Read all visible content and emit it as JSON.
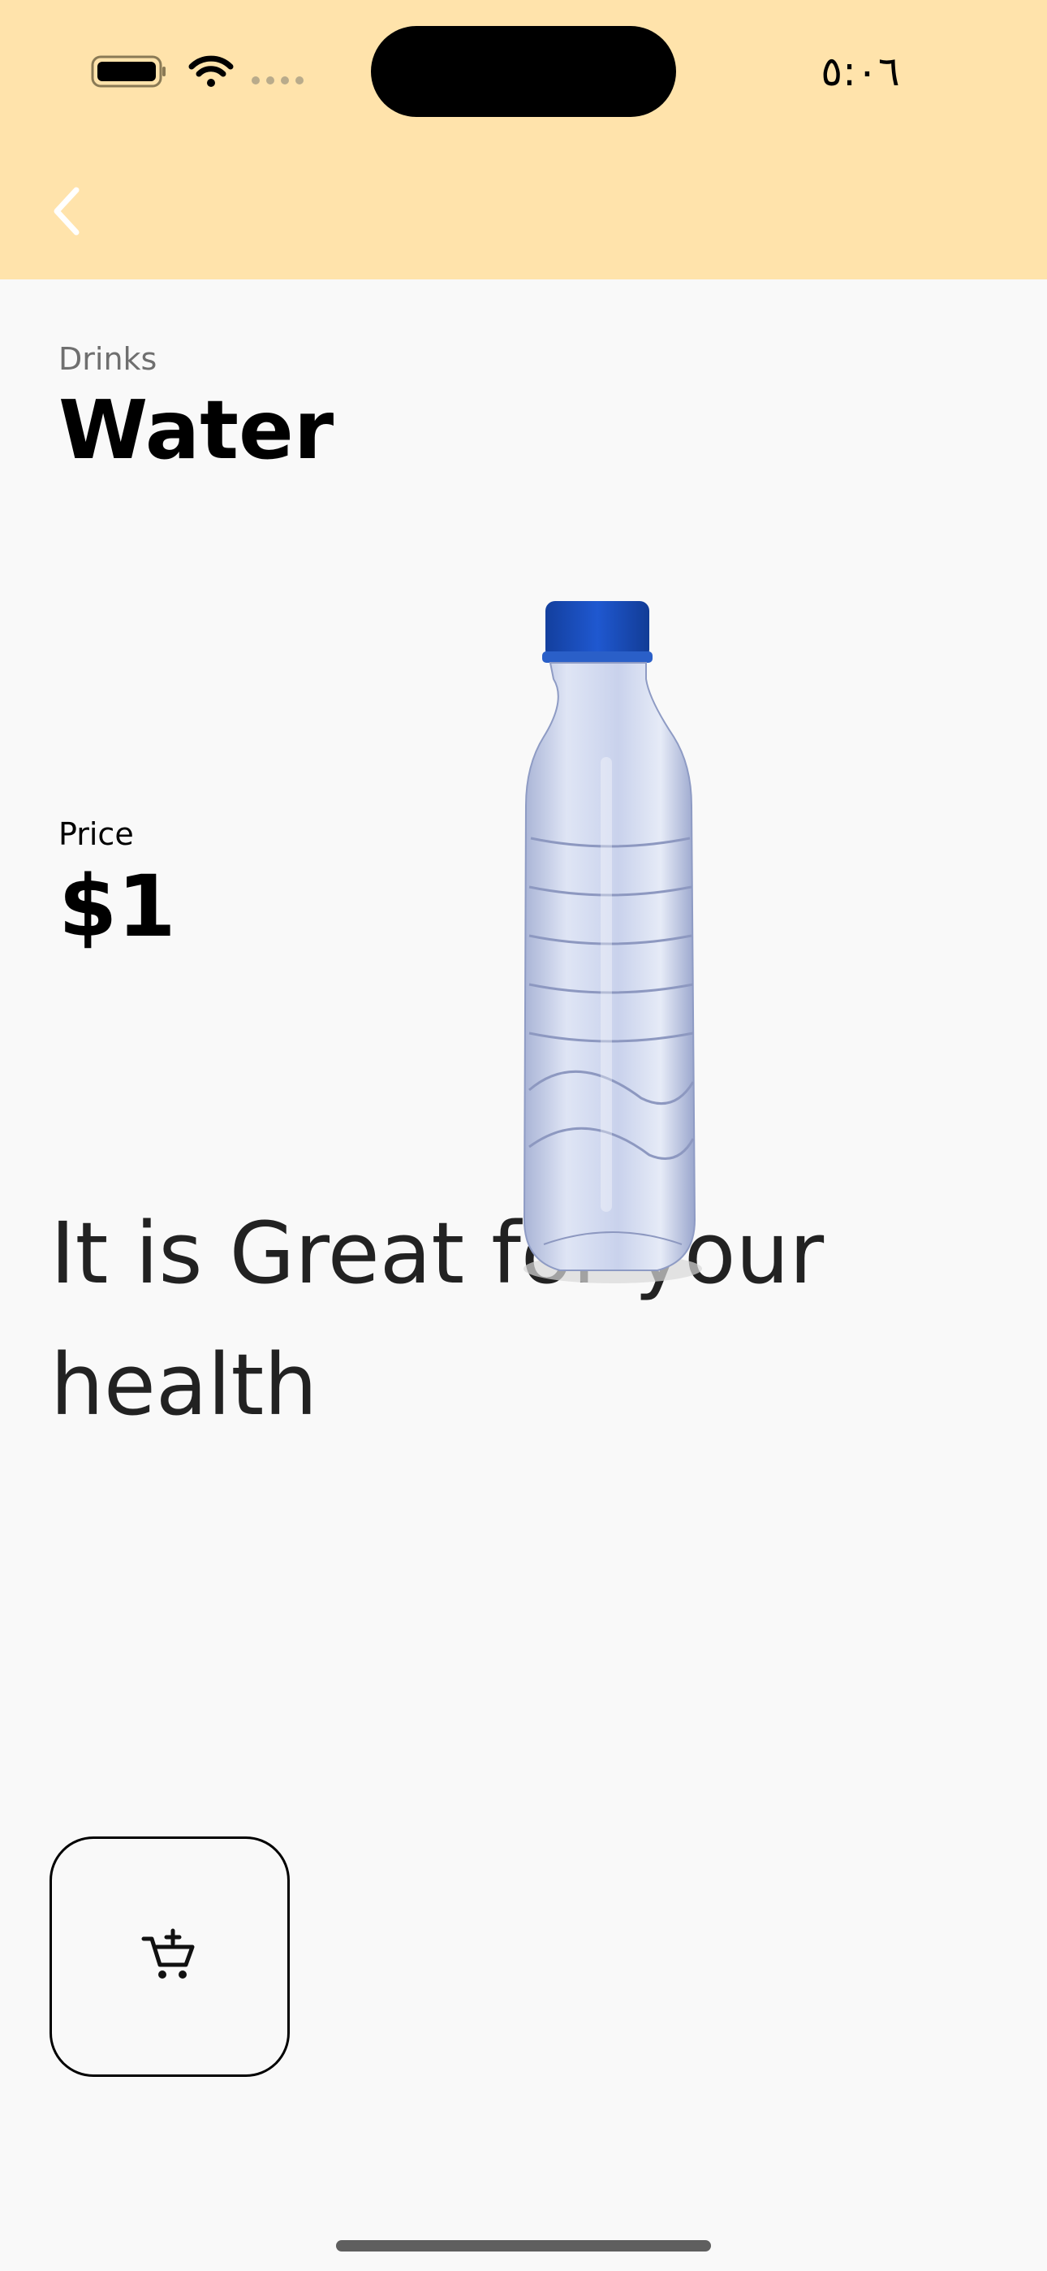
{
  "colors": {
    "header_background": "#ffe3ab",
    "page_background": "#f9f9f9",
    "back_arrow": "#ffffff",
    "bottle_cap": "#1b4fbf"
  },
  "status_bar": {
    "time": "٥:٠٦",
    "icons": [
      "battery-icon",
      "wifi-icon",
      "cellular-signal-icon"
    ]
  },
  "nav": {
    "back_icon": "chevron-left-icon"
  },
  "product": {
    "category": "Drinks",
    "name": "Water",
    "price_label": "Price",
    "price": "$1",
    "description": "It is Great for your health",
    "image": "water-bottle"
  },
  "actions": {
    "add_to_cart_icon": "cart-add-icon"
  }
}
